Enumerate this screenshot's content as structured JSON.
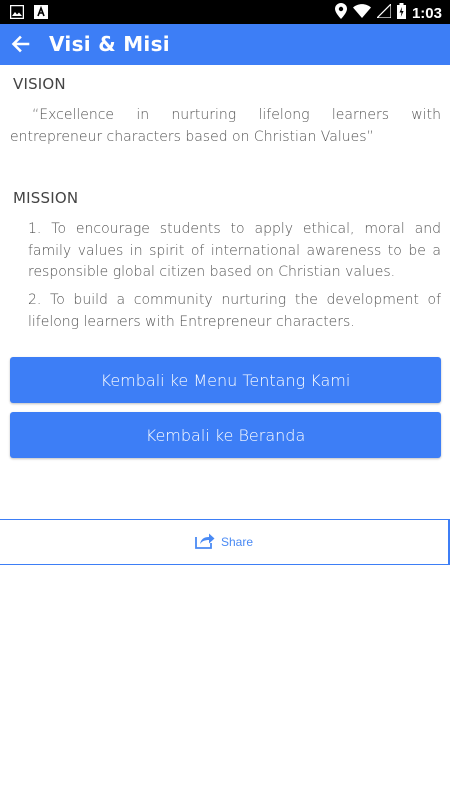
{
  "status_bar": {
    "time": "1:03",
    "icons": [
      "image-icon",
      "app-icon",
      "location-icon",
      "wifi-icon",
      "signal-icon",
      "battery-icon"
    ]
  },
  "app_bar": {
    "title": "Visi & Misi",
    "back_icon": "arrow-left-icon"
  },
  "vision": {
    "heading": "VISION",
    "text": "“Excellence in nurturing lifelong learners with entrepreneur characters based on Christian Values”"
  },
  "mission": {
    "heading": "MISSION",
    "items": [
      "1. To encourage students to apply ethical, moral and family values in spirit of international awareness to be a responsible global citizen based on Christian values.",
      "2. To build a community nurturing the development of lifelong learners with Entrepreneur characters."
    ]
  },
  "buttons": {
    "about_menu": "Kembali ke Menu Tentang Kami",
    "home": "Kembali ke Beranda"
  },
  "share": {
    "label": "Share",
    "icon": "share-icon"
  },
  "colors": {
    "primary": "#3d7ef6",
    "status_bar": "#000000"
  }
}
